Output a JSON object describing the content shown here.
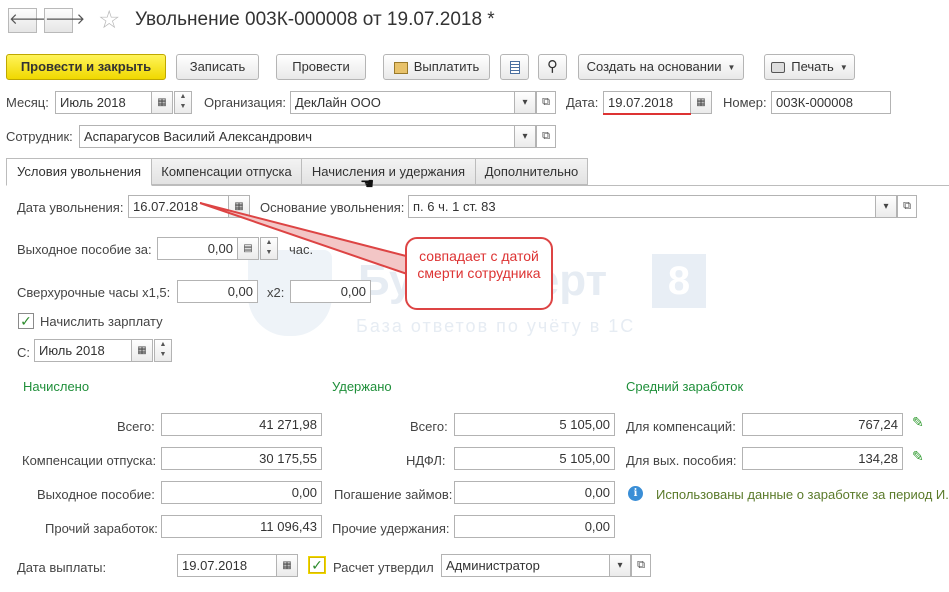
{
  "title": "Увольнение 003К-000008 от 19.07.2018 *",
  "nav": {
    "back": "🡐",
    "forward": "🡒"
  },
  "toolbar": {
    "post_close": "Провести и закрыть",
    "save": "Записать",
    "post": "Провести",
    "pay": "Выплатить",
    "create_based": "Создать на основании",
    "print": "Печать"
  },
  "header": {
    "month_label": "Месяц:",
    "month_value": "Июль 2018",
    "org_label": "Организация:",
    "org_value": "ДекЛайн ООО",
    "date_label": "Дата:",
    "date_value": "19.07.2018",
    "number_label": "Номер:",
    "number_value": "003К-000008",
    "employee_label": "Сотрудник:",
    "employee_value": "Аспарагусов Василий Александрович"
  },
  "tabs": [
    {
      "label": "Условия увольнения",
      "active": true
    },
    {
      "label": "Компенсации отпуска",
      "active": false
    },
    {
      "label": "Начисления и удержания",
      "active": false
    },
    {
      "label": "Дополнительно",
      "active": false
    }
  ],
  "conditions": {
    "dismissal_date_label": "Дата увольнения:",
    "dismissal_date_value": "16.07.2018",
    "reason_label": "Основание увольнения:",
    "reason_value": "п. 6 ч. 1 ст. 83",
    "severance_label": "Выходное пособие за:",
    "severance_value": "0,00",
    "severance_unit": "час.",
    "overtime_label": "Сверхурочные часы х1,5:",
    "overtime_x15_value": "0,00",
    "overtime_x2_label": "х2:",
    "overtime_x2_value": "0,00",
    "accrue_salary_label": "Начислить зарплату",
    "accrue_salary_checked": true,
    "from_label": "С:",
    "from_value": "Июль 2018"
  },
  "accrued": {
    "header": "Начислено",
    "total_label": "Всего:",
    "total_value": "41 271,98",
    "vacation_label": "Компенсации отпуска:",
    "vacation_value": "30 175,55",
    "severance_label": "Выходное пособие:",
    "severance_value": "0,00",
    "other_label": "Прочий заработок:",
    "other_value": "11 096,43"
  },
  "withheld": {
    "header": "Удержано",
    "total_label": "Всего:",
    "total_value": "5 105,00",
    "ndfl_label": "НДФЛ:",
    "ndfl_value": "5 105,00",
    "loans_label": "Погашение займов:",
    "loans_value": "0,00",
    "other_label": "Прочие удержания:",
    "other_value": "0,00"
  },
  "average": {
    "header": "Средний заработок",
    "comp_label": "Для компенсаций:",
    "comp_value": "767,24",
    "sev_label": "Для вых. пособия:",
    "sev_value": "134,28",
    "info_text": "Использованы данные о заработке за период И."
  },
  "footer": {
    "pay_date_label": "Дата выплаты:",
    "pay_date_value": "19.07.2018",
    "approved_label": "Расчет утвердил",
    "approved_checked": true,
    "approved_value": "Администратор"
  },
  "callout": {
    "text": "совпадает с датой смерти сотрудника"
  },
  "watermark": {
    "brand": "Бухэксперт",
    "badge": "8",
    "tagline": "База ответов по учёту в 1С"
  },
  "colors": {
    "primary_button": "#f5e21a",
    "accent_green": "#1f8f3a",
    "callout_red": "#dd3333"
  }
}
